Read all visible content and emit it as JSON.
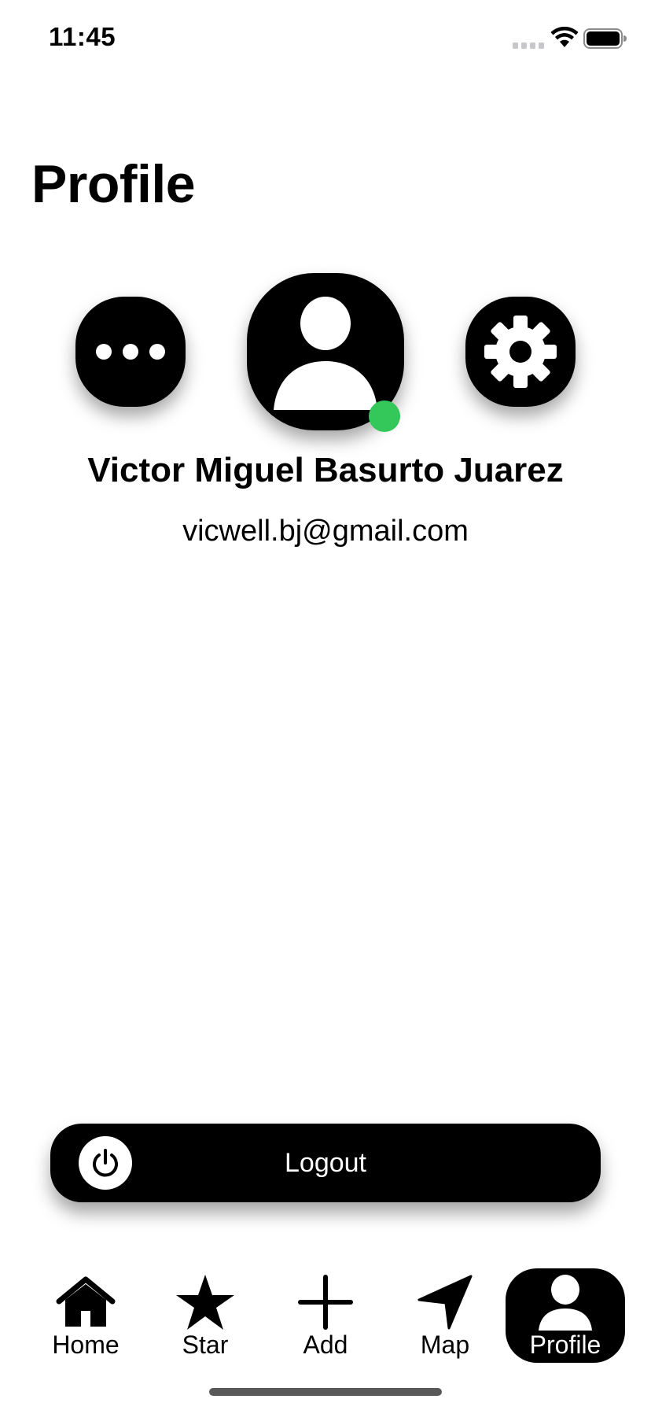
{
  "status_bar": {
    "time": "11:45",
    "icons": [
      "signal-icon",
      "wifi-icon",
      "battery-icon"
    ]
  },
  "page": {
    "title": "Profile"
  },
  "profile": {
    "name": "Victor Miguel Basurto Juarez",
    "email": "vicwell.bj@gmail.com",
    "status": "online",
    "status_color": "#34c759"
  },
  "actions": {
    "more_icon": "ellipsis-icon",
    "avatar_icon": "person-icon",
    "settings_icon": "gear-icon"
  },
  "logout": {
    "label": "Logout",
    "icon": "power-icon"
  },
  "tabs": [
    {
      "label": "Home",
      "icon": "house-icon",
      "active": false
    },
    {
      "label": "Star",
      "icon": "star-icon",
      "active": false
    },
    {
      "label": "Add",
      "icon": "plus-icon",
      "active": false
    },
    {
      "label": "Map",
      "icon": "location-arrow-icon",
      "active": false
    },
    {
      "label": "Profile",
      "icon": "person-icon",
      "active": true
    }
  ],
  "colors": {
    "background": "#ffffff",
    "primary": "#000000",
    "on_primary": "#ffffff",
    "online": "#34c759"
  }
}
